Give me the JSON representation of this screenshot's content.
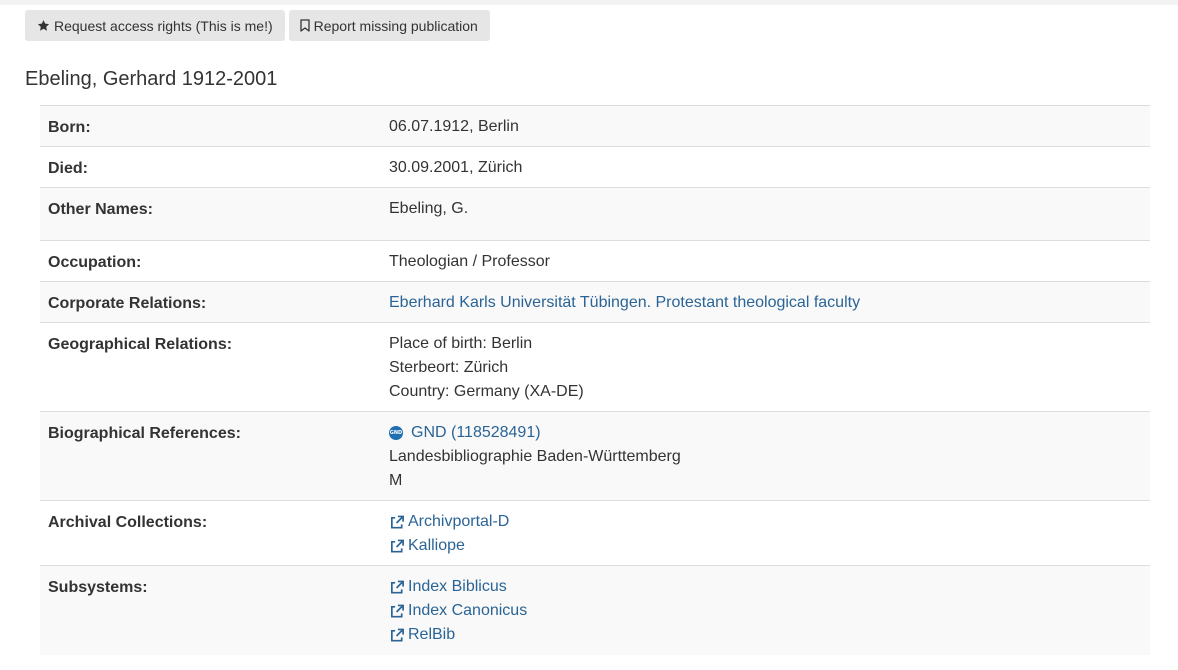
{
  "toolbar": {
    "request_access_label": "Request access rights (This is me!)",
    "report_missing_label": "Report missing publication"
  },
  "person": {
    "title": "Ebeling, Gerhard 1912-2001"
  },
  "rows": {
    "born": {
      "label": "Born:",
      "value": "06.07.1912, Berlin"
    },
    "died": {
      "label": "Died:",
      "value": "30.09.2001, Zürich"
    },
    "other_names": {
      "label": "Other Names:",
      "value": "Ebeling, G."
    },
    "occupation": {
      "label": "Occupation:",
      "value": "Theologian / Professor"
    },
    "corporate": {
      "label": "Corporate Relations:",
      "link": "Eberhard Karls Universität Tübingen. Protestant theological faculty"
    },
    "geographical": {
      "label": "Geographical Relations:",
      "lines": [
        "Place of birth: Berlin",
        "Sterbeort: Zürich",
        "Country: Germany (XA-DE)"
      ]
    },
    "biographical": {
      "label": "Biographical References:",
      "gnd_badge": "GND",
      "gnd_link": "GND (118528491)",
      "lines": [
        "Landesbibliographie Baden-Württemberg",
        "M"
      ]
    },
    "archival": {
      "label": "Archival Collections:",
      "links": [
        "Archivportal-D",
        "Kalliope"
      ]
    },
    "subsystems": {
      "label": "Subsystems:",
      "links": [
        "Index Biblicus",
        "Index Canonicus",
        "RelBib"
      ]
    }
  },
  "colors": {
    "link": "#2a6496",
    "button_bg": "#e6e6e6",
    "row_stripe": "#f9f9f9",
    "border": "#dddddd"
  },
  "icons": {
    "request_access": "star-icon",
    "report_missing": "bookmark-icon",
    "external": "external-link-icon",
    "gnd": "gnd-icon"
  }
}
